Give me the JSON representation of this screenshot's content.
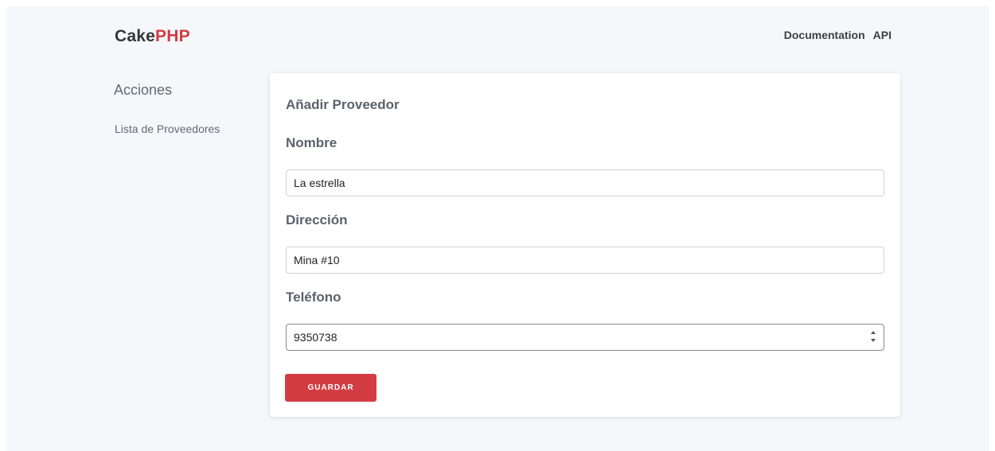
{
  "brand": {
    "cake": "Cake",
    "php": "PHP"
  },
  "top_nav": {
    "documentation": "Documentation",
    "api": "API"
  },
  "sidebar": {
    "heading": "Acciones",
    "links": [
      {
        "label": "Lista de Proveedores"
      }
    ]
  },
  "form": {
    "legend": "Añadir Proveedor",
    "fields": [
      {
        "label": "Nombre",
        "value": "La estrella"
      },
      {
        "label": "Dirección",
        "value": "Mina #10"
      },
      {
        "label": "Teléfono",
        "value": "9350738"
      }
    ],
    "submit_label": "GUARDAR"
  },
  "colors": {
    "accent": "#d33c43",
    "background": "#f5f7fa"
  }
}
